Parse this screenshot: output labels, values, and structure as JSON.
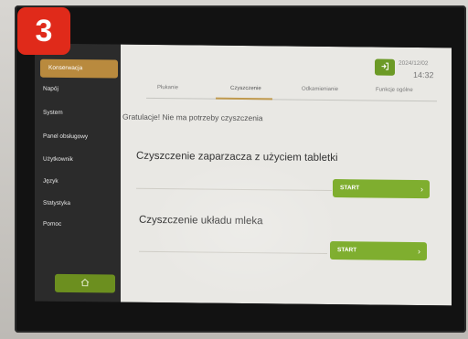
{
  "step_number": "3",
  "sidebar": {
    "items": [
      {
        "label": "Konserwacja",
        "active": true
      },
      {
        "label": "Napój"
      },
      {
        "label": "System"
      },
      {
        "label": "Panel obsługowy"
      },
      {
        "label": "Użytkownik"
      },
      {
        "label": "Język"
      },
      {
        "label": "Statystyka"
      },
      {
        "label": "Pomoc"
      }
    ],
    "home_icon": "home-icon"
  },
  "header": {
    "date": "2024/12/02",
    "time": "14:32",
    "exit_icon": "exit-icon"
  },
  "tabs": [
    {
      "label": "Płukanie"
    },
    {
      "label": "Czyszczenie",
      "active": true
    },
    {
      "label": "Odkamienianie"
    },
    {
      "label": "Funkcje ogólne"
    }
  ],
  "main": {
    "message": "Gratulacje! Nie ma potrzeby czyszczenia",
    "sections": [
      {
        "title": "Czyszczenie zaparzacza z użyciem tabletki",
        "button_label": "START"
      },
      {
        "title": "Czyszczenie układu mleka",
        "button_label": "START"
      }
    ]
  },
  "colors": {
    "accent_green": "#7fae2f",
    "active_tab": "#c09a4e",
    "active_sidebar": "#b98a3e",
    "badge_red": "#e02a1a"
  }
}
